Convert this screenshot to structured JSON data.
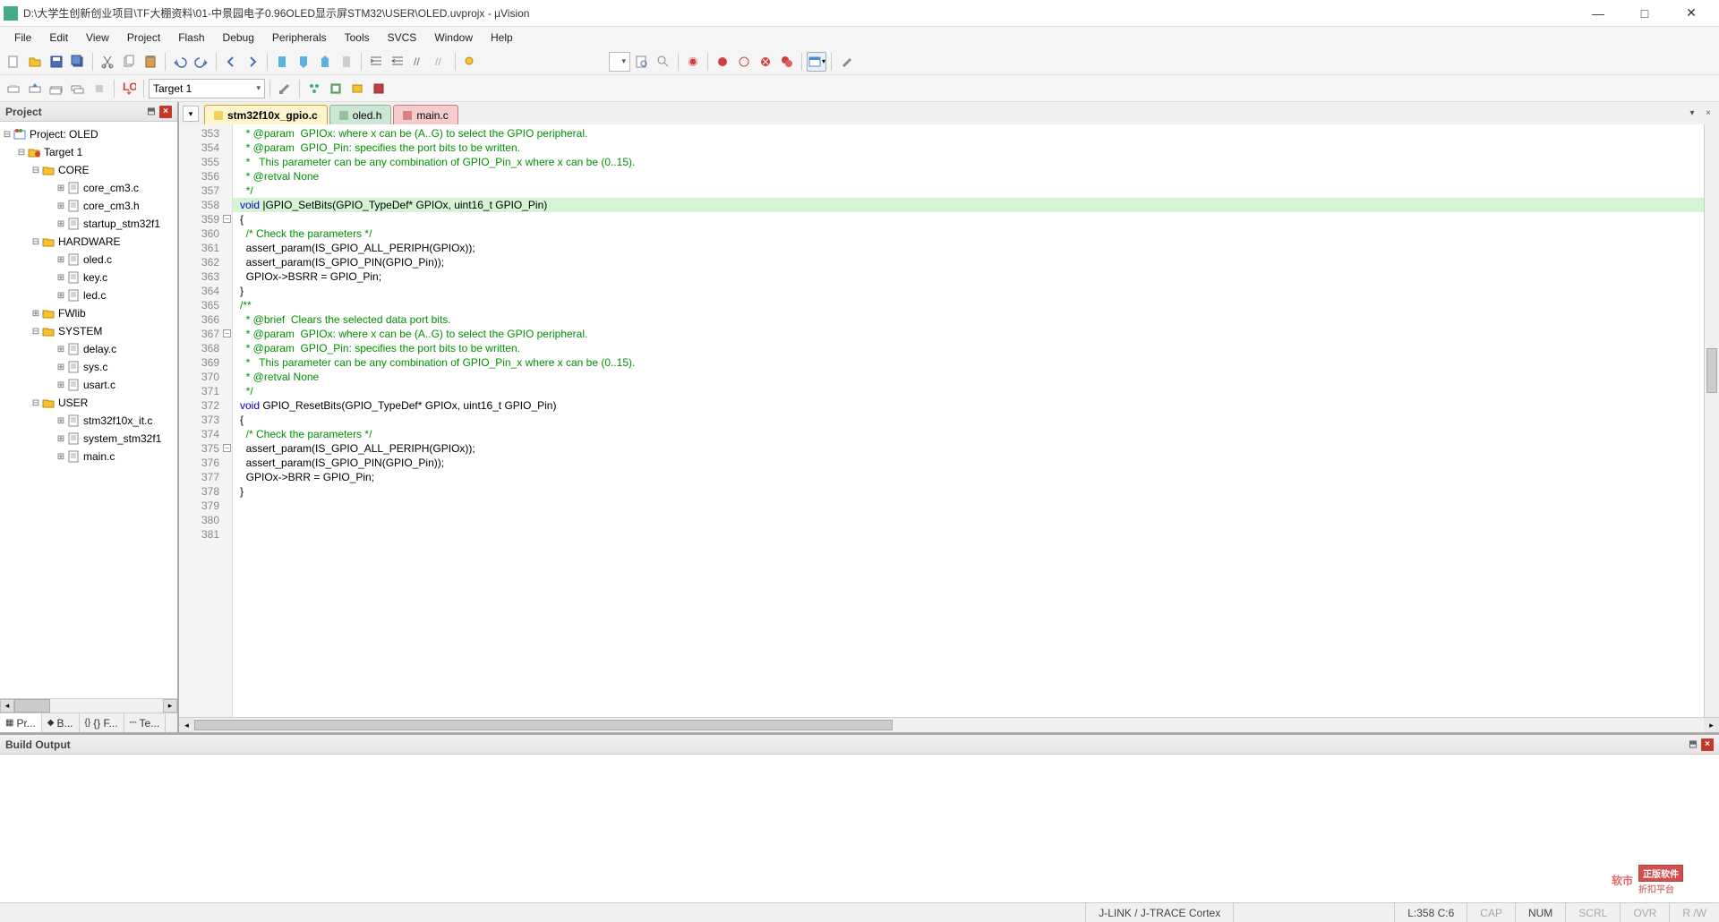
{
  "title": "D:\\大学生创新创业项目\\TF大棚资料\\01-中景园电子0.96OLED显示屏STM32\\USER\\OLED.uvprojx - µVision",
  "menu": [
    "File",
    "Edit",
    "View",
    "Project",
    "Flash",
    "Debug",
    "Peripherals",
    "Tools",
    "SVCS",
    "Window",
    "Help"
  ],
  "targetCombo": "Target 1",
  "panel": {
    "title": "Project"
  },
  "tree": {
    "root": "Project: OLED",
    "target": "Target 1",
    "groups": [
      {
        "name": "CORE",
        "files": [
          "core_cm3.c",
          "core_cm3.h",
          "startup_stm32f1"
        ]
      },
      {
        "name": "HARDWARE",
        "files": [
          "oled.c",
          "key.c",
          "led.c"
        ]
      },
      {
        "name": "FWlib",
        "files": []
      },
      {
        "name": "SYSTEM",
        "files": [
          "delay.c",
          "sys.c",
          "usart.c"
        ]
      },
      {
        "name": "USER",
        "files": [
          "stm32f10x_it.c",
          "system_stm32f1",
          "main.c"
        ]
      }
    ]
  },
  "bottomtabs": [
    "Pr...",
    "B...",
    "{} F...",
    "Te..."
  ],
  "editorTabs": [
    {
      "name": "stm32f10x_gpio.c",
      "state": "active"
    },
    {
      "name": "oled.h",
      "state": "header"
    },
    {
      "name": "main.c",
      "state": "modified"
    }
  ],
  "code": {
    "startLine": 353,
    "lines": [
      {
        "n": 353,
        "t": "  * @param  GPIOx: where x can be (A..G) to select the GPIO peripheral.",
        "c": "cm"
      },
      {
        "n": 354,
        "t": "  * @param  GPIO_Pin: specifies the port bits to be written.",
        "c": "cm"
      },
      {
        "n": 355,
        "t": "  *   This parameter can be any combination of GPIO_Pin_x where x can be (0..15).",
        "c": "cm"
      },
      {
        "n": 356,
        "t": "  * @retval None",
        "c": "cm"
      },
      {
        "n": 357,
        "t": "  */",
        "c": "cm"
      },
      {
        "n": 358,
        "t": "void |GPIO_SetBits(GPIO_TypeDef* GPIOx, uint16_t GPIO_Pin)",
        "c": "hl",
        "kw": "void"
      },
      {
        "n": 359,
        "t": "{",
        "fold": "-"
      },
      {
        "n": 360,
        "t": "  /* Check the parameters */",
        "c": "cm"
      },
      {
        "n": 361,
        "t": "  assert_param(IS_GPIO_ALL_PERIPH(GPIOx));"
      },
      {
        "n": 362,
        "t": "  assert_param(IS_GPIO_PIN(GPIO_Pin));"
      },
      {
        "n": 363,
        "t": ""
      },
      {
        "n": 364,
        "t": "  GPIOx->BSRR = GPIO_Pin;"
      },
      {
        "n": 365,
        "t": "}"
      },
      {
        "n": 366,
        "t": ""
      },
      {
        "n": 367,
        "t": "/**",
        "c": "cm",
        "fold": "-"
      },
      {
        "n": 368,
        "t": "  * @brief  Clears the selected data port bits.",
        "c": "cm"
      },
      {
        "n": 369,
        "t": "  * @param  GPIOx: where x can be (A..G) to select the GPIO peripheral.",
        "c": "cm"
      },
      {
        "n": 370,
        "t": "  * @param  GPIO_Pin: specifies the port bits to be written.",
        "c": "cm"
      },
      {
        "n": 371,
        "t": "  *   This parameter can be any combination of GPIO_Pin_x where x can be (0..15).",
        "c": "cm"
      },
      {
        "n": 372,
        "t": "  * @retval None",
        "c": "cm"
      },
      {
        "n": 373,
        "t": "  */",
        "c": "cm"
      },
      {
        "n": 374,
        "t": "void GPIO_ResetBits(GPIO_TypeDef* GPIOx, uint16_t GPIO_Pin)",
        "kw": "void"
      },
      {
        "n": 375,
        "t": "{",
        "fold": "-"
      },
      {
        "n": 376,
        "t": "  /* Check the parameters */",
        "c": "cm"
      },
      {
        "n": 377,
        "t": "  assert_param(IS_GPIO_ALL_PERIPH(GPIOx));"
      },
      {
        "n": 378,
        "t": "  assert_param(IS_GPIO_PIN(GPIO_Pin));"
      },
      {
        "n": 379,
        "t": ""
      },
      {
        "n": 380,
        "t": "  GPIOx->BRR = GPIO_Pin;"
      },
      {
        "n": 381,
        "t": "}"
      }
    ]
  },
  "buildout": {
    "title": "Build Output"
  },
  "watermark": {
    "text": "软市",
    "badge": "正版软件",
    "sub": "折扣平台"
  },
  "status": {
    "debugger": "J-LINK / J-TRACE Cortex",
    "pos": "L:358 C:6",
    "caps": "CAP",
    "num": "NUM",
    "scrl": "SCRL",
    "ovr": "OVR",
    "rw": "R /W"
  }
}
